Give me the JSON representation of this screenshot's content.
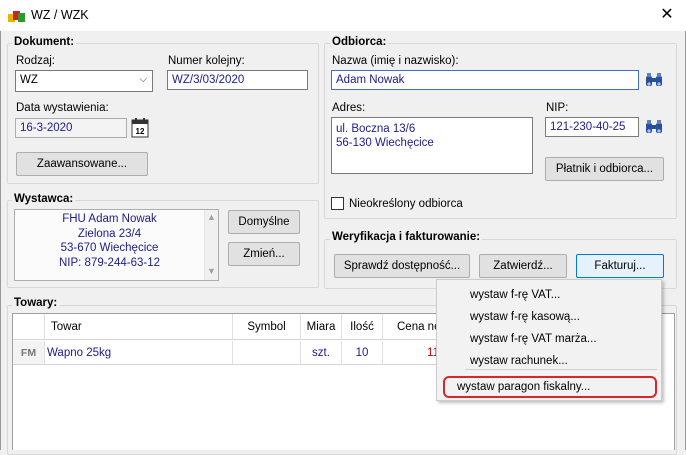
{
  "window": {
    "title": "WZ / WZK",
    "close": "✕"
  },
  "dokument": {
    "title": "Dokument:",
    "rodzaj_label": "Rodzaj:",
    "rodzaj_value": "WZ",
    "numer_label": "Numer kolejny:",
    "numer_value": "WZ/3/03/2020",
    "data_label": "Data wystawienia:",
    "data_value": "16-3-2020",
    "calendar_day": "12",
    "advanced_button": "Zaawansowane..."
  },
  "odbiorca": {
    "title": "Odbiorca:",
    "nazwa_label": "Nazwa (imię i nazwisko):",
    "nazwa_value": "Adam Nowak",
    "adres_label": "Adres:",
    "adres_line1": "ul. Boczna 13/6",
    "adres_line2": "56-130 Wiechęcice",
    "nip_label": "NIP:",
    "nip_value": "121-230-40-25",
    "payer_button": "Płatnik i odbiorca...",
    "undefined_checkbox": "Nieokreślony odbiorca"
  },
  "wystawca": {
    "title": "Wystawca:",
    "line1": "FHU Adam Nowak",
    "line2": "Zielona 23/4",
    "line3": "53-670 Wiechęcice",
    "line4": "NIP: 879-244-63-12",
    "default_button": "Domyślne",
    "change_button": "Zmień..."
  },
  "weryfikacja": {
    "title": "Weryfikacja i fakturowanie:",
    "check_button": "Sprawdź dostępność...",
    "approve_button": "Zatwierdź...",
    "invoice_button": "Fakturuj..."
  },
  "towary": {
    "title": "Towary:",
    "columns": [
      "Towar",
      "Symbol",
      "Miara",
      "Ilość",
      "Cena ne"
    ],
    "rows": [
      {
        "badge": "FM",
        "towar": "Wapno 25kg",
        "symbol": "",
        "miara": "szt.",
        "ilosc": "10",
        "cena": "11"
      }
    ]
  },
  "menu": {
    "items": [
      "wystaw f-rę VAT...",
      "wystaw f-rę kasową...",
      "wystaw f-rę VAT marża...",
      "wystaw rachunek...",
      "wystaw paragon fiskalny..."
    ]
  },
  "colors": {
    "field_text": "#1c1c8c",
    "highlight": "#d9262a",
    "price_red": "#c00000"
  }
}
